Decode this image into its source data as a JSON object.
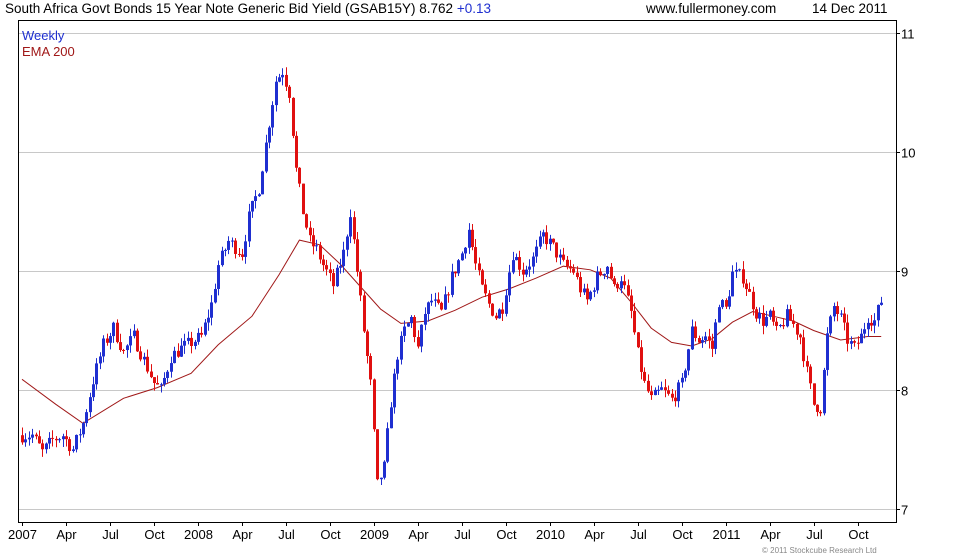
{
  "header": {
    "title": "South Africa Govt Bonds 15 Year Note Generic Bid Yield (GSAB15Y)",
    "last_value": "8.762",
    "change": "+0.13",
    "website": "www.fullermoney.com",
    "date": "14 Dec 2011"
  },
  "footer": {
    "copyright": "© 2011 Stockcube Research Ltd"
  },
  "colors": {
    "up": "#1f2fd0",
    "down": "#e01010",
    "ema": "#a01818",
    "grid": "#c8c8c8",
    "frame": "#000000"
  },
  "chart_data": {
    "type": "candlestick",
    "interval": "Weekly",
    "legend": [
      {
        "name": "Weekly",
        "color": "#1f2fd0"
      },
      {
        "name": "EMA 200",
        "color": "#a01818"
      }
    ],
    "ylim": [
      6.95,
      11.1
    ],
    "y_ticks": [
      7,
      8,
      9,
      10,
      11
    ],
    "x_ticks": [
      "2007",
      "Apr",
      "Jul",
      "Oct",
      "2008",
      "Apr",
      "Jul",
      "Oct",
      "2009",
      "Apr",
      "Jul",
      "Oct",
      "2010",
      "Apr",
      "Jul",
      "Oct",
      "2011",
      "Apr",
      "Jul",
      "Oct"
    ],
    "x_range_weeks": [
      0,
      256
    ],
    "grid": true,
    "yield_path": [
      [
        0,
        7.62
      ],
      [
        3,
        7.62
      ],
      [
        6,
        7.48
      ],
      [
        9,
        7.58
      ],
      [
        12,
        7.62
      ],
      [
        15,
        7.5
      ],
      [
        18,
        7.72
      ],
      [
        21,
        8.08
      ],
      [
        24,
        8.38
      ],
      [
        27,
        8.52
      ],
      [
        30,
        8.32
      ],
      [
        33,
        8.45
      ],
      [
        36,
        8.25
      ],
      [
        39,
        8.06
      ],
      [
        41,
        8.0
      ],
      [
        44,
        8.28
      ],
      [
        47,
        8.35
      ],
      [
        50,
        8.4
      ],
      [
        53,
        8.45
      ],
      [
        56,
        8.72
      ],
      [
        58,
        9.05
      ],
      [
        61,
        9.25
      ],
      [
        63,
        9.2
      ],
      [
        65,
        9.15
      ],
      [
        67,
        9.45
      ],
      [
        70,
        9.7
      ],
      [
        73,
        10.25
      ],
      [
        75,
        10.6
      ],
      [
        77,
        10.68
      ],
      [
        79,
        10.5
      ],
      [
        81,
        9.85
      ],
      [
        83,
        9.5
      ],
      [
        85,
        9.25
      ],
      [
        87,
        9.18
      ],
      [
        89,
        9.05
      ],
      [
        92,
        8.88
      ],
      [
        95,
        9.15
      ],
      [
        97,
        9.5
      ],
      [
        99,
        9.0
      ],
      [
        101,
        8.5
      ],
      [
        103,
        8.05
      ],
      [
        105,
        7.2
      ],
      [
        107,
        7.35
      ],
      [
        109,
        7.9
      ],
      [
        111,
        8.3
      ],
      [
        113,
        8.5
      ],
      [
        115,
        8.6
      ],
      [
        117,
        8.35
      ],
      [
        119,
        8.65
      ],
      [
        121,
        8.75
      ],
      [
        124,
        8.65
      ],
      [
        127,
        8.95
      ],
      [
        130,
        9.15
      ],
      [
        132,
        9.35
      ],
      [
        134,
        9.05
      ],
      [
        136,
        8.85
      ],
      [
        138,
        8.72
      ],
      [
        140,
        8.62
      ],
      [
        142,
        8.7
      ],
      [
        145,
        9.15
      ],
      [
        148,
        9.0
      ],
      [
        151,
        9.1
      ],
      [
        154,
        9.3
      ],
      [
        157,
        9.2
      ],
      [
        160,
        9.05
      ],
      [
        163,
        9.0
      ],
      [
        165,
        8.85
      ],
      [
        167,
        8.75
      ],
      [
        170,
        8.95
      ],
      [
        173,
        9.05
      ],
      [
        175,
        8.85
      ],
      [
        177,
        8.95
      ],
      [
        180,
        8.65
      ],
      [
        182,
        8.3
      ],
      [
        184,
        8.05
      ],
      [
        186,
        7.92
      ],
      [
        189,
        8.0
      ],
      [
        192,
        7.92
      ],
      [
        195,
        8.05
      ],
      [
        198,
        8.5
      ],
      [
        200,
        8.42
      ],
      [
        202,
        8.45
      ],
      [
        204,
        8.35
      ],
      [
        206,
        8.75
      ],
      [
        208,
        8.68
      ],
      [
        210,
        8.98
      ],
      [
        213,
        8.95
      ],
      [
        215,
        8.8
      ],
      [
        217,
        8.65
      ],
      [
        219,
        8.58
      ],
      [
        221,
        8.62
      ],
      [
        223,
        8.48
      ],
      [
        226,
        8.62
      ],
      [
        228,
        8.55
      ],
      [
        230,
        8.45
      ],
      [
        232,
        8.15
      ],
      [
        234,
        7.88
      ],
      [
        236,
        7.85
      ],
      [
        238,
        8.45
      ],
      [
        240,
        8.7
      ],
      [
        242,
        8.6
      ],
      [
        244,
        8.42
      ],
      [
        246,
        8.35
      ],
      [
        248,
        8.45
      ],
      [
        250,
        8.62
      ],
      [
        252,
        8.58
      ],
      [
        254,
        8.75
      ]
    ],
    "ema_200": [
      [
        0,
        8.09
      ],
      [
        10,
        7.88
      ],
      [
        18,
        7.72
      ],
      [
        30,
        7.93
      ],
      [
        40,
        8.02
      ],
      [
        50,
        8.14
      ],
      [
        58,
        8.38
      ],
      [
        68,
        8.62
      ],
      [
        76,
        8.97
      ],
      [
        82,
        9.26
      ],
      [
        88,
        9.22
      ],
      [
        94,
        9.06
      ],
      [
        100,
        8.87
      ],
      [
        106,
        8.68
      ],
      [
        112,
        8.56
      ],
      [
        120,
        8.58
      ],
      [
        128,
        8.67
      ],
      [
        136,
        8.78
      ],
      [
        144,
        8.85
      ],
      [
        152,
        8.94
      ],
      [
        160,
        9.04
      ],
      [
        168,
        9.01
      ],
      [
        174,
        8.94
      ],
      [
        180,
        8.74
      ],
      [
        186,
        8.52
      ],
      [
        192,
        8.4
      ],
      [
        198,
        8.37
      ],
      [
        204,
        8.43
      ],
      [
        210,
        8.57
      ],
      [
        216,
        8.66
      ],
      [
        222,
        8.62
      ],
      [
        228,
        8.58
      ],
      [
        234,
        8.5
      ],
      [
        242,
        8.42
      ],
      [
        250,
        8.45
      ],
      [
        254,
        8.45
      ]
    ]
  }
}
